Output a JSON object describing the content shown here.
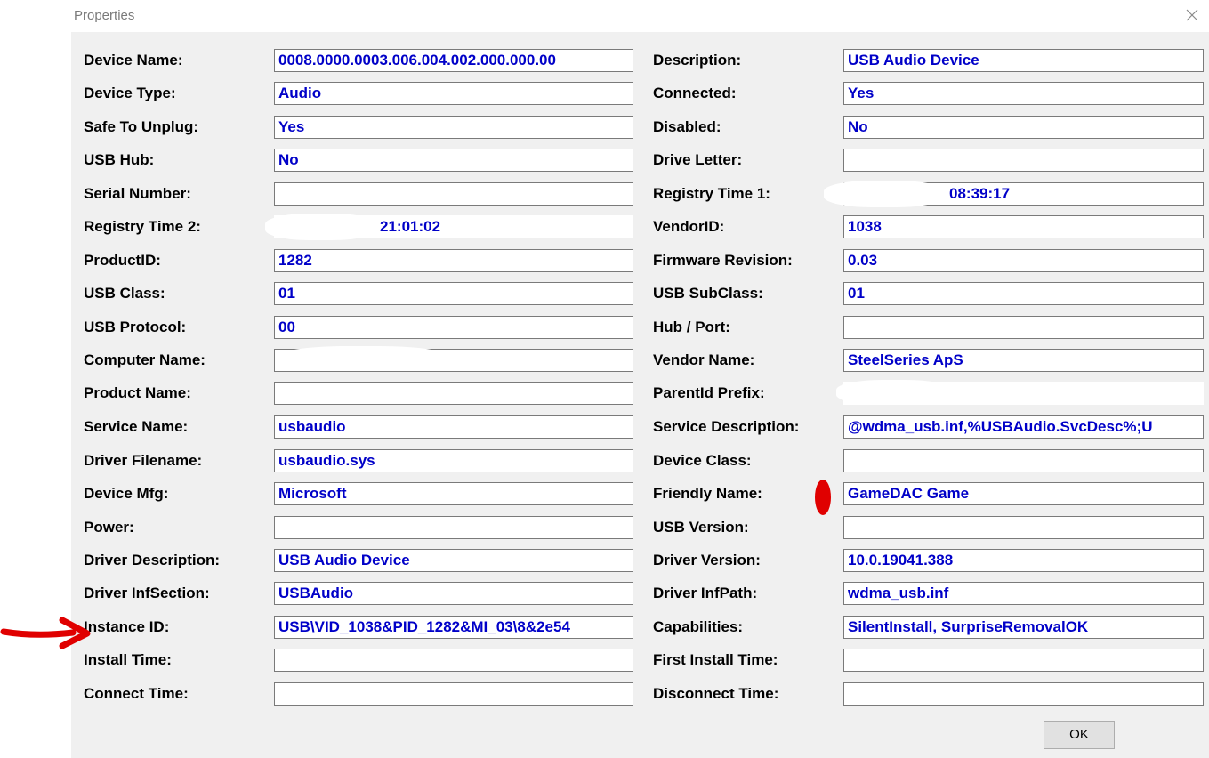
{
  "window": {
    "title": "Properties",
    "ok_label": "OK"
  },
  "fields_left": [
    {
      "label": "Device Name:",
      "value": "0008.0000.0003.006.004.002.000.000.00"
    },
    {
      "label": "Device Type:",
      "value": "Audio"
    },
    {
      "label": "Safe To Unplug:",
      "value": "Yes"
    },
    {
      "label": "USB Hub:",
      "value": "No"
    },
    {
      "label": "Serial Number:",
      "value": ""
    },
    {
      "label": "Registry Time 2:",
      "value": "21:01:02"
    },
    {
      "label": "ProductID:",
      "value": "1282"
    },
    {
      "label": "USB Class:",
      "value": "01"
    },
    {
      "label": "USB Protocol:",
      "value": "00"
    },
    {
      "label": "Computer Name:",
      "value": ""
    },
    {
      "label": "Product Name:",
      "value": ""
    },
    {
      "label": "Service Name:",
      "value": "usbaudio"
    },
    {
      "label": "Driver Filename:",
      "value": "usbaudio.sys"
    },
    {
      "label": "Device Mfg:",
      "value": "Microsoft"
    },
    {
      "label": "Power:",
      "value": ""
    },
    {
      "label": "Driver Description:",
      "value": "USB Audio Device"
    },
    {
      "label": "Driver InfSection:",
      "value": "USBAudio"
    },
    {
      "label": "Instance ID:",
      "value": "USB\\VID_1038&PID_1282&MI_03\\8&2e54"
    },
    {
      "label": "Install Time:",
      "value": ""
    },
    {
      "label": "Connect Time:",
      "value": ""
    }
  ],
  "fields_right": [
    {
      "label": "Description:",
      "value": "USB Audio Device"
    },
    {
      "label": "Connected:",
      "value": "Yes"
    },
    {
      "label": "Disabled:",
      "value": "No"
    },
    {
      "label": "Drive Letter:",
      "value": ""
    },
    {
      "label": "Registry Time 1:",
      "value": "08:39:17"
    },
    {
      "label": "VendorID:",
      "value": "1038"
    },
    {
      "label": "Firmware Revision:",
      "value": "0.03"
    },
    {
      "label": "USB SubClass:",
      "value": "01"
    },
    {
      "label": "Hub / Port:",
      "value": ""
    },
    {
      "label": "Vendor Name:",
      "value": "SteelSeries ApS"
    },
    {
      "label": "ParentId Prefix:",
      "value": ""
    },
    {
      "label": "Service Description:",
      "value": "@wdma_usb.inf,%USBAudio.SvcDesc%;U"
    },
    {
      "label": "Device Class:",
      "value": ""
    },
    {
      "label": "Friendly Name:",
      "value": "GameDAC Game"
    },
    {
      "label": "USB Version:",
      "value": ""
    },
    {
      "label": "Driver Version:",
      "value": "10.0.19041.388"
    },
    {
      "label": "Driver InfPath:",
      "value": "wdma_usb.inf"
    },
    {
      "label": "Capabilities:",
      "value": "SilentInstall, SurpriseRemovalOK"
    },
    {
      "label": "First Install Time:",
      "value": ""
    },
    {
      "label": "Disconnect Time:",
      "value": ""
    }
  ],
  "colors": {
    "value_text": "#0000c8",
    "annotation": "#e00000",
    "dialog_bg": "#f0f0f0"
  }
}
